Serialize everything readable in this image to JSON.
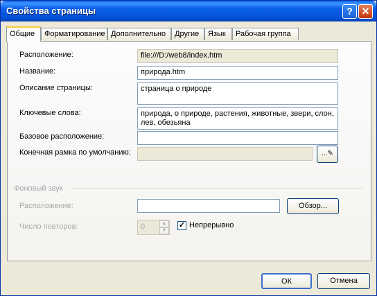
{
  "window": {
    "title": "Свойства страницы",
    "help_glyph": "?",
    "close_glyph": "✕"
  },
  "tabs": [
    {
      "label": "Общие"
    },
    {
      "label": "Форматирование"
    },
    {
      "label": "Дополнительно"
    },
    {
      "label": "Другие"
    },
    {
      "label": "Язык"
    },
    {
      "label": "Рабочая группа"
    }
  ],
  "general": {
    "location_label": "Расположение:",
    "location_value": "file:///D:/web8/index.htm",
    "title_label": "Название:",
    "title_value": "природа.htm",
    "description_label": "Описание страницы:",
    "description_value": "страница о природе",
    "keywords_label": "Ключевые слова:",
    "keywords_value": "природа, о природе, растения, животные, звери, слон, лев, обезьяна",
    "base_location_label": "Базовое расположение:",
    "base_location_value": "",
    "default_frame_label": "Конечная рамка по умолчанию:",
    "default_frame_value": "",
    "frame_button_glyph": "...✎"
  },
  "background_sound": {
    "section_label": "Фоновый звук",
    "location_label": "Расположение:",
    "location_value": "",
    "browse_label": "Обзор...",
    "loop_label": "Число повторов:",
    "loop_value": "0",
    "continuous_label": "Непрерывно",
    "continuous_checked": true
  },
  "footer": {
    "ok_label": "ОК",
    "cancel_label": "Отмена"
  }
}
